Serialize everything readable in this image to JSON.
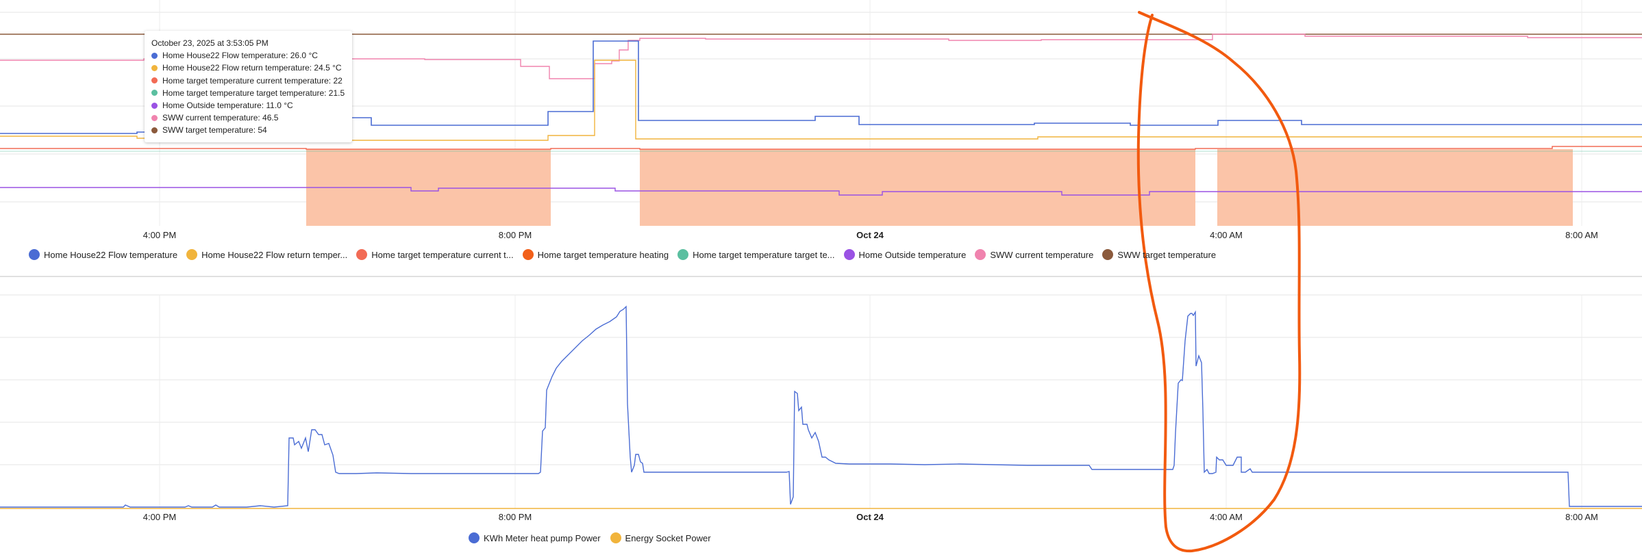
{
  "colors": {
    "flow": "#4a6cd4",
    "flow_return": "#f1b43c",
    "target_current": "#f26b55",
    "heating": "#f2601a",
    "target_target": "#5bbfa0",
    "outside": "#9a52e4",
    "sww_current": "#f083ae",
    "sww_target": "#8b5a3c",
    "heating_band": "#fbc4a8",
    "annotation": "#f25a0f",
    "energy_socket": "#f1b43c",
    "meter": "#4a6cd4"
  },
  "top_chart": {
    "x_ticks": [
      {
        "label": "4:00 PM",
        "bold": false
      },
      {
        "label": "8:00 PM",
        "bold": false
      },
      {
        "label": "Oct 24",
        "bold": true
      },
      {
        "label": "4:00 AM",
        "bold": false
      },
      {
        "label": "8:00 AM",
        "bold": false
      }
    ],
    "legend": [
      {
        "label": "Home House22 Flow temperature",
        "color": "#4a6cd4"
      },
      {
        "label": "Home House22 Flow return temper...",
        "color": "#f1b43c"
      },
      {
        "label": "Home target temperature current t...",
        "color": "#f26b55"
      },
      {
        "label": "Home target temperature heating",
        "color": "#f2601a"
      },
      {
        "label": "Home target temperature target te...",
        "color": "#5bbfa0"
      },
      {
        "label": "Home Outside temperature",
        "color": "#9a52e4"
      },
      {
        "label": "SWW current temperature",
        "color": "#f083ae"
      },
      {
        "label": "SWW target temperature",
        "color": "#8b5a3c"
      }
    ],
    "tooltip": {
      "title": "October 23, 2025 at 3:53:05 PM",
      "rows": [
        {
          "text": "Home House22 Flow temperature: 26.0 °C",
          "color": "#4a6cd4"
        },
        {
          "text": "Home House22 Flow return temperature: 24.5 °C",
          "color": "#f1b43c"
        },
        {
          "text": "Home target temperature current temperature: 22",
          "color": "#f26b55"
        },
        {
          "text": "Home target temperature target temperature: 21.5",
          "color": "#5bbfa0"
        },
        {
          "text": "Home Outside temperature: 11.0 °C",
          "color": "#9a52e4"
        },
        {
          "text": "SWW current temperature: 46.5",
          "color": "#f083ae"
        },
        {
          "text": "SWW target temperature: 54",
          "color": "#8b5a3c"
        }
      ]
    }
  },
  "bottom_chart": {
    "x_ticks": [
      {
        "label": "4:00 PM",
        "bold": false
      },
      {
        "label": "8:00 PM",
        "bold": false
      },
      {
        "label": "Oct 24",
        "bold": true
      },
      {
        "label": "4:00 AM",
        "bold": false
      },
      {
        "label": "8:00 AM",
        "bold": false
      }
    ],
    "legend": [
      {
        "label": "KWh Meter heat pump Power",
        "color": "#4a6cd4"
      },
      {
        "label": "Energy Socket Power",
        "color": "#f1b43c"
      }
    ]
  }
}
